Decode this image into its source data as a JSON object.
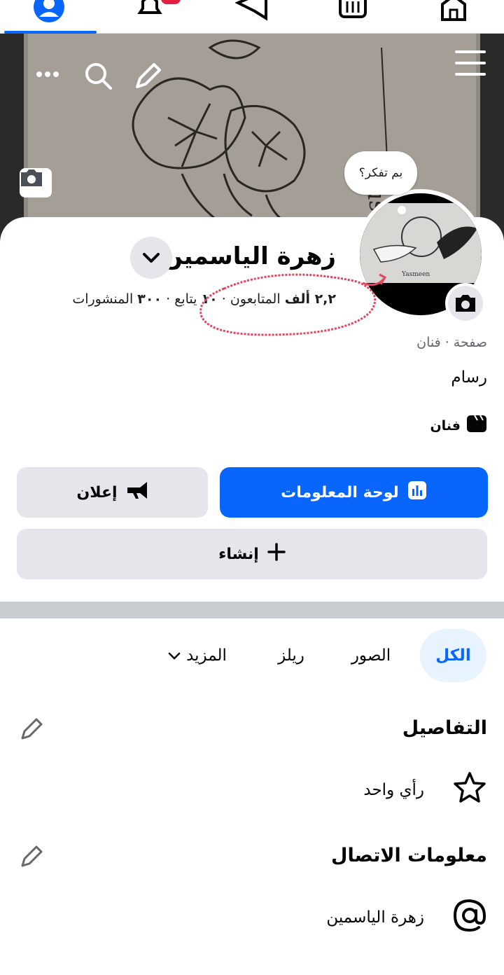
{
  "nav": {
    "items": [
      "profile-icon",
      "bell-icon",
      "megaphone-icon",
      "marketplace-icon",
      "home-icon"
    ],
    "accent": "#0866ff"
  },
  "cover": {
    "signature": "Yasmeen"
  },
  "bubble": {
    "text": "بم تفكر؟"
  },
  "page": {
    "name": "زهرة الياسمين",
    "stats": {
      "followers_count": "٢,٢ ألف",
      "followers_label": "المتابعون",
      "sep1": " · ",
      "following_count": "١٠",
      "following_label": "يتابع",
      "sep2": " · ",
      "posts_count": "٣٠٠",
      "posts_label": "المنشورات"
    },
    "category": "صفحة · فنان",
    "bio": "رسام",
    "profession": "فنان"
  },
  "actions": {
    "dashboard": "لوحة المعلومات",
    "ad": "إعلان",
    "create": "إنشاء"
  },
  "tabs": {
    "all": "الكل",
    "photos": "الصور",
    "reels": "ريلز",
    "more": "المزيد"
  },
  "details": {
    "title": "التفاصيل",
    "rating": "رأي واحد"
  },
  "contact": {
    "title": "معلومات الاتصال",
    "username": "زهرة الياسمين"
  },
  "colors": {
    "primary": "#0866ff",
    "notification": "#e41e3f",
    "annotation": "#e0475f"
  }
}
